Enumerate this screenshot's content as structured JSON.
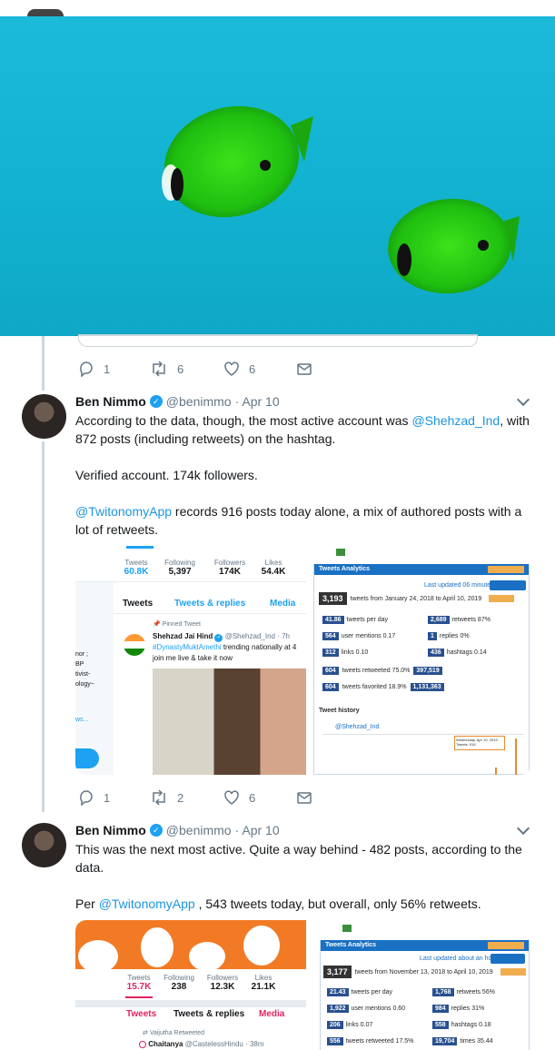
{
  "photo": {
    "icon": "butterflyfish-photo"
  },
  "tweet0_actions": {
    "replies": "1",
    "retweets": "6",
    "likes": "6"
  },
  "tweet1": {
    "name": "Ben Nimmo",
    "handle": "@benimmo",
    "date": "· Apr 10",
    "text_a": "According to the data, though, the most active account was ",
    "mention_a": "@Shehzad_Ind",
    "text_b": ", with 872 posts (including retweets) on the hashtag.",
    "para2": "Verified account. 174k followers.",
    "mention_b": "@TwitonomyApp",
    "text_c": " records 916 posts today alone, a mix of authored posts with a lot of retweets.",
    "actions": {
      "replies": "1",
      "retweets": "2",
      "likes": "6"
    },
    "media": {
      "profile": {
        "stats": [
          {
            "label": "Tweets",
            "value": "60.8K"
          },
          {
            "label": "Following",
            "value": "5,397"
          },
          {
            "label": "Followers",
            "value": "174K"
          },
          {
            "label": "Likes",
            "value": "54.4K"
          }
        ],
        "tabs": [
          "Tweets",
          "Tweets & replies",
          "Media"
        ],
        "pinned": "Pinned Tweet",
        "tweet_name": "Shehzad Jai Hind",
        "tweet_handle": "@Shehzad_Ind · 7h",
        "tweet_tag": "#DynastyMuktAmethi",
        "tweet_line1": " trending nationally at 4",
        "tweet_line2": "join me live & take it now",
        "side": [
          "nor ;",
          "BP",
          "tivist-",
          "ology~",
          "ws..."
        ]
      },
      "analytics": {
        "title": "Tweets Analytics",
        "updated": "Last updated 06 minutes ago",
        "total": "3,193",
        "total_desc": "tweets from January 24, 2018 to April 10, 2019",
        "rows": [
          {
            "a": "41.86",
            "a_desc": "tweets per day",
            "b": "2,689",
            "b_desc": "retweets 87%"
          },
          {
            "a": "564",
            "a_desc": "user mentions 0.17",
            "b": "1",
            "b_desc": "replies 0%"
          },
          {
            "a": "312",
            "a_desc": "links 0.10",
            "b": "436",
            "b_desc": "hashtags 0.14"
          }
        ],
        "rt1": "604",
        "rt1_desc": "tweets retweeted 75.0%",
        "rt1_total": "397,519",
        "rt2": "604",
        "rt2_desc": "tweets favorited 18.9%",
        "rt2_total": "1,131,363",
        "history": "Tweet history",
        "account": "@Shehzad_Ind",
        "tooltip": "Wednesday, Apr 10, 2019",
        "tooltip_val": "Tweets: 916"
      }
    }
  },
  "tweet2": {
    "name": "Ben Nimmo",
    "handle": "@benimmo",
    "date": "· Apr 10",
    "text_a": "This was the next most active. Quite a way behind - 482 posts, according to the data.",
    "text_b": "Per ",
    "mention": "@TwitonomyApp",
    "text_c": " , 543 tweets today, but overall, only 56% retweets.",
    "media": {
      "stats": [
        {
          "label": "Tweets",
          "value": "15.7K"
        },
        {
          "label": "Following",
          "value": "238"
        },
        {
          "label": "Followers",
          "value": "12.3K"
        },
        {
          "label": "Likes",
          "value": "21.1K"
        }
      ],
      "tabs": [
        "Tweets",
        "Tweets & replies",
        "Media"
      ],
      "retweeted": "Vaijutha Retweeted",
      "tweet_name": "Chaitanya",
      "tweet_handle": "@CastelessHindu · 38m",
      "analytics": {
        "title": "Tweets Analytics",
        "updated": "Last updated about an hour ago",
        "total": "3,177",
        "total_desc": "tweets from November 13, 2018 to April 10, 2019",
        "rows": [
          {
            "a": "21.43",
            "a_desc": "tweets per day",
            "b": "1,768",
            "b_desc": "retweets 56%"
          },
          {
            "a": "1,922",
            "a_desc": "user mentions 0.60",
            "b": "984",
            "b_desc": "replies 31%"
          },
          {
            "a": "206",
            "a_desc": "links 0.07",
            "b": "558",
            "b_desc": "hashtags 0.18"
          },
          {
            "a": "556",
            "a_desc": "tweets retweeted 17.5%",
            "b": "19,704",
            "b_desc": "times 35.44"
          }
        ]
      }
    }
  }
}
